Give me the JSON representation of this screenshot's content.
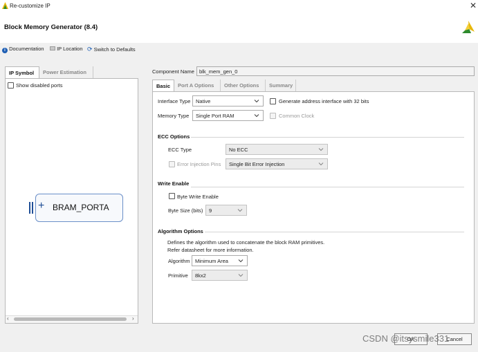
{
  "window": {
    "title": "Re-customize IP",
    "close_glyph": "✕"
  },
  "header": {
    "app_title": "Block Memory Generator (8.4)",
    "logo_icon": "vivado-logo-icon"
  },
  "toolbar": {
    "documentation": "Documentation",
    "ip_location": "IP Location",
    "switch_defaults": "Switch to Defaults"
  },
  "left_panel": {
    "tabs": [
      "IP Symbol",
      "Power Estimation"
    ],
    "active_tab": "IP Symbol",
    "show_disabled_ports": "Show disabled ports",
    "symbol": {
      "port_label": "BRAM_PORTA",
      "expand_glyph": "+"
    }
  },
  "right_panel": {
    "component_name_label": "Component Name",
    "component_name_value": "blk_mem_gen_0",
    "tabs": [
      "Basic",
      "Port A Options",
      "Other Options",
      "Summary"
    ],
    "active_tab": "Basic",
    "interface_type_label": "Interface Type",
    "interface_type_value": "Native",
    "generate_address_label": "Generate address interface with 32 bits",
    "memory_type_label": "Memory Type",
    "memory_type_value": "Single Port RAM",
    "common_clock_label": "Common Clock",
    "ecc": {
      "title": "ECC Options",
      "type_label": "ECC Type",
      "type_value": "No ECC",
      "error_injection_label": "Error Injection Pins",
      "error_injection_value": "Single Bit Error Injection"
    },
    "write_enable": {
      "title": "Write Enable",
      "byte_write_label": "Byte Write Enable",
      "byte_size_label": "Byte Size (bits)",
      "byte_size_value": "9"
    },
    "algorithm": {
      "title": "Algorithm Options",
      "desc_line1": "Defines the algorithm used to concatenate the block RAM primitives.",
      "desc_line2": "Refer datasheet for more information.",
      "algorithm_label": "Algorithm",
      "algorithm_value": "Minimum Area",
      "primitive_label": "Primitive",
      "primitive_value": "8kx2"
    }
  },
  "footer": {
    "ok": "OK",
    "cancel": "Cancel",
    "watermark": "CSDN @itsysmile331"
  },
  "colors": {
    "accent": "#1f4e96",
    "logo_yellow": "#e8b80c",
    "logo_green": "#2e8b2e"
  }
}
